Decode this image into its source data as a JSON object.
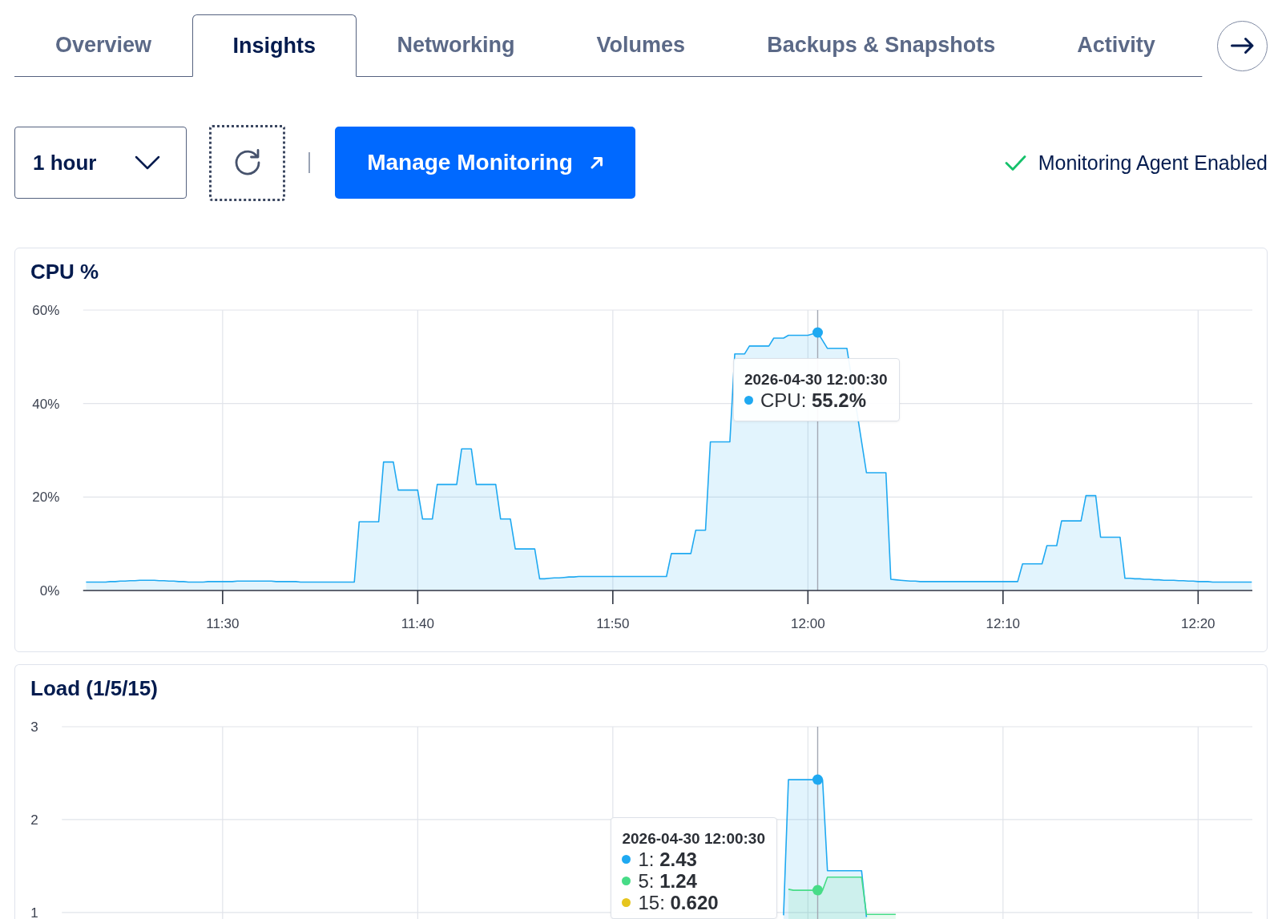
{
  "tabs": [
    {
      "label": "Overview",
      "selected": false
    },
    {
      "label": "Insights",
      "selected": true
    },
    {
      "label": "Networking",
      "selected": false
    },
    {
      "label": "Volumes",
      "selected": false
    },
    {
      "label": "Backups & Snapshots",
      "selected": false
    },
    {
      "label": "Activity",
      "selected": false
    }
  ],
  "toolbar": {
    "time_range": {
      "value": "1 hour"
    },
    "refresh_button": {
      "focused": true
    },
    "manage_button": {
      "label": "Manage Monitoring"
    },
    "agent_status": {
      "label": "Monitoring Agent Enabled",
      "enabled": true
    }
  },
  "charts": [
    {
      "title": "CPU %",
      "chart_data": {
        "type": "area",
        "categories": [
          null,
          null,
          null,
          null,
          null,
          null,
          null,
          null,
          null,
          null,
          null,
          null,
          null,
          null,
          null,
          null,
          null,
          null,
          null,
          null,
          null,
          null,
          null,
          null,
          null,
          null,
          null,
          null,
          "11:30",
          null,
          null,
          null,
          null,
          null,
          null,
          null,
          null,
          null,
          null,
          null,
          null,
          null,
          null,
          null,
          null,
          null,
          null,
          null,
          null,
          null,
          null,
          null,
          null,
          null,
          null,
          null,
          null,
          null,
          null,
          null,
          null,
          null,
          null,
          null,
          null,
          null,
          null,
          null,
          "11:40",
          null,
          null,
          null,
          null,
          null,
          null,
          null,
          null,
          null,
          null,
          null,
          null,
          null,
          null,
          null,
          null,
          null,
          null,
          null,
          null,
          null,
          null,
          null,
          null,
          null,
          null,
          null,
          null,
          null,
          null,
          null,
          null,
          null,
          null,
          null,
          null,
          null,
          null,
          null,
          "11:50",
          null,
          null,
          null,
          null,
          null,
          null,
          null,
          null,
          null,
          null,
          null,
          null,
          null,
          null,
          null,
          null,
          null,
          null,
          null,
          null,
          null,
          null,
          null,
          null,
          null,
          null,
          null,
          null,
          null,
          null,
          null,
          null,
          null,
          null,
          null,
          null,
          null,
          null,
          null,
          "12:00",
          null,
          null,
          null,
          null,
          null,
          null,
          null,
          null,
          null,
          null,
          null,
          null,
          null,
          null,
          null,
          null,
          null,
          null,
          null,
          null,
          null,
          null,
          null,
          null,
          null,
          null,
          null,
          null,
          null,
          null,
          null,
          null,
          null,
          null,
          null,
          null,
          null,
          null,
          null,
          "12:10",
          null,
          null,
          null,
          null,
          null,
          null,
          null,
          null,
          null,
          null,
          null,
          null,
          null,
          null,
          null,
          null,
          null,
          null,
          null,
          null,
          null,
          null,
          null,
          null,
          null,
          null,
          null,
          null,
          null,
          null,
          null,
          null,
          null,
          null,
          null,
          null,
          null,
          null,
          null,
          "12:20",
          null,
          null,
          null,
          null,
          null,
          null,
          null,
          null,
          null,
          null,
          null
        ],
        "ylim": [
          0,
          60
        ],
        "yticks": [
          {
            "value": 0,
            "label": "0%"
          },
          {
            "value": 20,
            "label": "20%"
          },
          {
            "value": 40,
            "label": "40%"
          },
          {
            "value": 60,
            "label": "60%"
          }
        ],
        "series": [
          {
            "color": "#1fa9f1",
            "values": [
              1.8,
              1.8,
              1.8,
              1.8,
              1.8,
              1.9,
              1.9,
              2.0,
              2.0,
              2.1,
              2.1,
              2.2,
              2.2,
              2.2,
              2.2,
              2.1,
              2.1,
              2.0,
              2.0,
              1.9,
              1.9,
              1.8,
              1.8,
              1.8,
              1.8,
              1.9,
              1.9,
              1.9,
              1.9,
              1.9,
              1.9,
              2.0,
              2.0,
              2.0,
              2.0,
              2.0,
              2.0,
              2.0,
              2.0,
              1.9,
              1.9,
              1.9,
              1.9,
              1.9,
              1.8,
              1.8,
              1.8,
              1.8,
              1.8,
              1.8,
              1.8,
              1.8,
              1.8,
              1.8,
              1.8,
              1.8,
              14.7,
              14.7,
              14.7,
              14.7,
              14.7,
              27.5,
              27.5,
              27.5,
              21.5,
              21.5,
              21.5,
              21.5,
              21.5,
              15.3,
              15.3,
              15.3,
              22.7,
              22.7,
              22.7,
              22.7,
              22.7,
              30.3,
              30.3,
              30.3,
              22.7,
              22.7,
              22.7,
              22.7,
              22.7,
              15.3,
              15.3,
              15.3,
              8.9,
              8.9,
              8.9,
              8.9,
              8.9,
              2.5,
              2.5,
              2.6,
              2.7,
              2.7,
              2.8,
              2.9,
              2.9,
              3.0,
              3.0,
              3.0,
              3.0,
              3.0,
              3.0,
              3.0,
              3.0,
              3.0,
              3.0,
              3.0,
              3.0,
              3.0,
              3.0,
              3.0,
              3.0,
              3.0,
              3.0,
              3.0,
              7.9,
              7.9,
              7.9,
              7.9,
              7.9,
              12.9,
              12.9,
              12.9,
              31.8,
              31.8,
              31.8,
              31.8,
              31.8,
              50.6,
              50.6,
              50.6,
              52.3,
              52.3,
              52.3,
              52.3,
              52.3,
              54.0,
              54.0,
              54.0,
              54.6,
              54.6,
              54.6,
              54.6,
              54.6,
              54.9,
              55.2,
              53.5,
              51.8,
              51.8,
              51.8,
              51.8,
              51.8,
              null,
              null,
              null,
              25.2,
              25.2,
              25.2,
              25.2,
              25.2,
              2.4,
              2.3,
              2.2,
              2.1,
              2.0,
              2.0,
              1.9,
              1.9,
              1.9,
              1.9,
              1.9,
              1.9,
              1.9,
              1.9,
              1.9,
              1.9,
              1.9,
              1.9,
              1.9,
              1.9,
              1.9,
              1.9,
              1.9,
              1.9,
              1.9,
              1.9,
              1.9,
              5.7,
              5.7,
              5.7,
              5.7,
              5.7,
              9.6,
              9.6,
              9.6,
              14.9,
              14.9,
              14.9,
              14.9,
              14.9,
              20.3,
              20.3,
              20.3,
              11.4,
              11.4,
              11.4,
              11.4,
              11.4,
              2.6,
              2.6,
              2.5,
              2.5,
              2.4,
              2.4,
              2.3,
              2.3,
              2.2,
              2.2,
              2.2,
              2.1,
              2.1,
              2.0,
              2.0,
              1.9,
              1.9,
              1.9,
              1.8,
              1.8,
              1.8,
              1.8,
              1.8,
              1.8,
              1.8,
              1.8,
              1.8
            ]
          }
        ]
      },
      "tooltip": {
        "title": "2026-04-30 12:00:30",
        "rows": [
          {
            "text": "CPU: **55.2%**",
            "color": "#1fa9f1"
          }
        ]
      }
    },
    {
      "title": "Load (1/5/15)",
      "chart_data": {
        "type": "area",
        "categories": [
          null,
          null,
          null,
          null,
          null,
          null,
          null,
          null,
          null,
          null,
          null,
          null,
          null,
          null,
          null,
          null,
          null,
          null,
          null,
          null,
          null,
          null,
          null,
          null,
          null,
          null,
          null,
          null,
          null,
          null,
          null,
          null,
          null,
          null,
          null,
          null,
          null,
          null,
          null,
          null,
          null,
          null,
          null,
          null,
          null,
          null,
          null,
          null,
          null,
          null,
          null,
          null,
          null,
          null,
          null,
          null,
          null,
          null,
          null,
          null,
          null,
          null,
          null,
          null,
          null,
          null,
          null,
          null,
          null,
          null,
          null,
          null,
          null,
          null,
          null,
          null,
          null,
          null,
          null,
          null,
          null,
          null,
          null,
          null,
          null,
          null,
          null,
          null,
          null,
          null,
          null,
          null,
          null,
          null,
          null,
          null,
          null,
          null,
          null,
          null,
          null,
          null,
          null,
          null,
          null,
          null,
          null,
          null,
          null,
          null,
          null,
          null,
          null,
          null,
          null,
          null,
          null,
          null,
          null,
          null,
          null,
          null,
          null,
          null,
          null,
          null,
          null,
          null,
          null,
          null,
          null,
          null,
          null,
          null,
          null,
          null,
          null,
          null,
          null,
          null,
          null,
          null,
          null,
          null,
          null,
          null,
          null,
          null,
          null,
          null,
          null,
          null,
          null,
          null,
          null,
          null,
          null,
          null,
          null,
          null,
          null,
          null,
          null,
          null,
          null,
          null,
          null,
          null,
          null,
          null,
          null,
          null,
          null,
          null,
          null,
          null,
          null,
          null,
          null,
          null,
          null,
          null,
          null,
          null,
          null,
          null,
          null,
          null,
          null,
          null,
          null,
          null,
          null,
          null,
          null,
          null,
          null,
          null,
          null,
          null,
          null,
          null,
          null,
          null,
          null,
          null,
          null,
          null,
          null,
          null,
          null,
          null,
          null,
          null,
          null,
          null,
          null,
          null,
          null,
          null,
          null,
          null,
          null,
          null,
          null,
          null,
          null,
          null,
          null,
          null,
          null,
          null,
          null,
          null,
          null,
          null,
          null,
          null,
          null,
          null
        ],
        "ylim": [
          0.93,
          3
        ],
        "yticks": [
          {
            "value": 1,
            "label": "1"
          },
          {
            "value": 2,
            "label": "2"
          },
          {
            "value": 3,
            "label": "3"
          }
        ],
        "series": [
          {
            "color": "#1fa9f1",
            "values": [
              null,
              null,
              null,
              null,
              null,
              null,
              null,
              null,
              null,
              null,
              null,
              null,
              null,
              null,
              null,
              null,
              null,
              null,
              null,
              null,
              null,
              null,
              null,
              null,
              null,
              null,
              null,
              null,
              null,
              null,
              null,
              null,
              null,
              null,
              null,
              null,
              null,
              null,
              null,
              null,
              null,
              null,
              null,
              null,
              null,
              null,
              null,
              null,
              null,
              null,
              null,
              null,
              null,
              null,
              null,
              null,
              null,
              null,
              null,
              null,
              null,
              null,
              null,
              null,
              null,
              null,
              null,
              null,
              null,
              null,
              null,
              null,
              null,
              null,
              null,
              null,
              null,
              null,
              null,
              null,
              null,
              null,
              null,
              null,
              null,
              null,
              null,
              null,
              null,
              null,
              null,
              null,
              null,
              null,
              null,
              null,
              null,
              null,
              null,
              null,
              null,
              null,
              null,
              null,
              null,
              null,
              null,
              null,
              null,
              null,
              null,
              null,
              null,
              null,
              null,
              null,
              null,
              null,
              null,
              null,
              null,
              null,
              null,
              null,
              null,
              null,
              null,
              null,
              null,
              null,
              null,
              null,
              null,
              null,
              null,
              null,
              null,
              null,
              null,
              null,
              null,
              null,
              null,
              0.97,
              2.43,
              2.43,
              2.43,
              2.43,
              2.43,
              2.43,
              2.43,
              2.43,
              1.45,
              1.45,
              1.45,
              1.45,
              1.45,
              1.45,
              1.45,
              1.45,
              0.95,
              null,
              null,
              null,
              null,
              null,
              null,
              null,
              null,
              null,
              null,
              null,
              null,
              null,
              null,
              null,
              null,
              null,
              null,
              null,
              null,
              null,
              null,
              null,
              null,
              null,
              null,
              null,
              null,
              null,
              null,
              null,
              null,
              null,
              null,
              null,
              null,
              null,
              null,
              null,
              null,
              null,
              null,
              null,
              null,
              null,
              null,
              null,
              null,
              null,
              null,
              null,
              null,
              null,
              null,
              null,
              null,
              null,
              null,
              null,
              null,
              null,
              null,
              null,
              null,
              null,
              null,
              null,
              null,
              null,
              null,
              null,
              null,
              null,
              null,
              null,
              null,
              null,
              null,
              null
            ]
          },
          {
            "color": "#47dc87",
            "values": [
              null,
              null,
              null,
              null,
              null,
              null,
              null,
              null,
              null,
              null,
              null,
              null,
              null,
              null,
              null,
              null,
              null,
              null,
              null,
              null,
              null,
              null,
              null,
              null,
              null,
              null,
              null,
              null,
              null,
              null,
              null,
              null,
              null,
              null,
              null,
              null,
              null,
              null,
              null,
              null,
              null,
              null,
              null,
              null,
              null,
              null,
              null,
              null,
              null,
              null,
              null,
              null,
              null,
              null,
              null,
              null,
              null,
              null,
              null,
              null,
              null,
              null,
              null,
              null,
              null,
              null,
              null,
              null,
              null,
              null,
              null,
              null,
              null,
              null,
              null,
              null,
              null,
              null,
              null,
              null,
              null,
              null,
              null,
              null,
              null,
              null,
              null,
              null,
              null,
              null,
              null,
              null,
              null,
              null,
              null,
              null,
              null,
              null,
              null,
              null,
              null,
              null,
              null,
              null,
              null,
              null,
              null,
              null,
              null,
              null,
              null,
              null,
              null,
              null,
              null,
              null,
              null,
              null,
              null,
              null,
              null,
              null,
              null,
              null,
              null,
              null,
              null,
              null,
              null,
              null,
              null,
              null,
              null,
              null,
              null,
              null,
              null,
              null,
              null,
              null,
              null,
              null,
              null,
              null,
              1.25,
              1.24,
              1.24,
              1.24,
              1.24,
              1.24,
              1.24,
              1.24,
              1.38,
              1.38,
              1.38,
              1.38,
              1.38,
              1.38,
              1.38,
              1.38,
              0.98,
              0.98,
              0.98,
              0.98,
              0.98,
              0.98,
              0.98,
              null,
              null,
              null,
              null,
              null,
              null,
              null,
              null,
              null,
              null,
              null,
              null,
              null,
              null,
              null,
              null,
              null,
              null,
              null,
              null,
              null,
              null,
              null,
              null,
              null,
              null,
              null,
              null,
              null,
              null,
              null,
              null,
              null,
              null,
              null,
              null,
              null,
              null,
              null,
              null,
              null,
              null,
              null,
              null,
              null,
              null,
              null,
              null,
              null,
              null,
              null,
              null,
              null,
              null,
              null,
              null,
              null,
              null,
              null,
              null,
              null,
              null,
              null,
              null,
              null,
              null,
              null,
              null,
              null,
              null,
              null,
              null,
              null
            ]
          }
        ]
      },
      "tooltip": {
        "title": "2026-04-30 12:00:30",
        "rows": [
          {
            "text": "1: **2.43**",
            "color": "#1fa9f1"
          },
          {
            "text": "5: **1.24**",
            "color": "#47dc87"
          },
          {
            "text": "15: **0.620**",
            "color": "#e6c51e"
          }
        ]
      }
    }
  ]
}
